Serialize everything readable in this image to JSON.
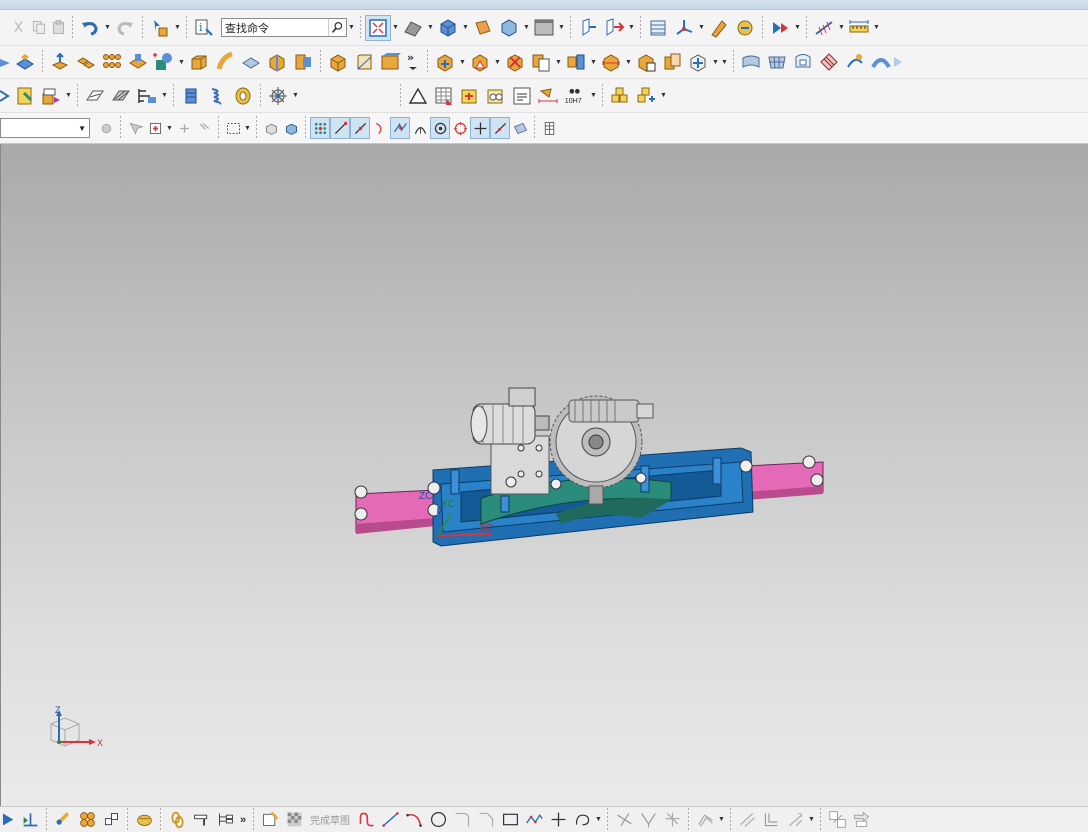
{
  "toolbar": {
    "search_placeholder": "查找命令",
    "overflow_chevron": "»"
  },
  "bottom_toolbar": {
    "overflow_chevron": "»",
    "finish_sketch_label": "完成草图"
  },
  "viewport": {
    "wcs_labels": {
      "z": "ZC",
      "y": "YC",
      "x": "XC"
    },
    "triad_labels": {
      "z": "Z",
      "x": "X"
    }
  },
  "dimension_icon": {
    "label": "10H7"
  },
  "colors": {
    "viewport_top": "#a9a9a9",
    "viewport_bottom": "#eaeaea",
    "frame_blue": "#1f6fb2",
    "slide_pink": "#e46ab8",
    "gear_gray": "#cfcfcf",
    "base_teal": "#2a8c7a"
  }
}
